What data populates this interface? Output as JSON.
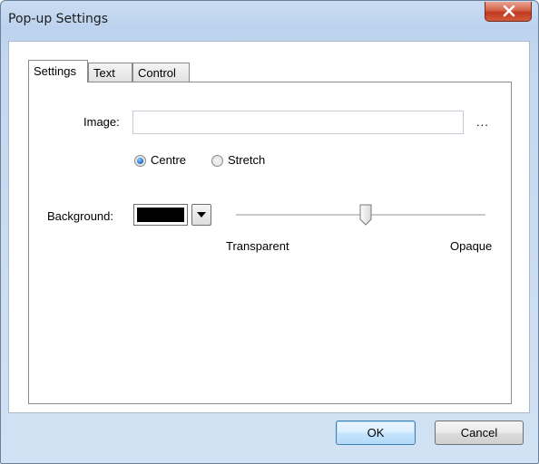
{
  "window": {
    "title": "Pop-up Settings"
  },
  "tabs": [
    {
      "label": "Settings",
      "active": true
    },
    {
      "label": "Text",
      "active": false
    },
    {
      "label": "Control",
      "active": false
    }
  ],
  "settings": {
    "image_label": "Image:",
    "image_value": "",
    "browse_label": "...",
    "radio_centre": "Centre",
    "radio_stretch": "Stretch",
    "selected_mode": "Centre",
    "background_label": "Background:",
    "background_color": "#000000",
    "opacity_min_label": "Transparent",
    "opacity_max_label": "Opaque",
    "opacity_level": 0.52
  },
  "buttons": {
    "ok": "OK",
    "cancel": "Cancel"
  },
  "icons": {
    "close": "close-icon",
    "dropdown": "chevron-down-icon",
    "slider": "slider-thumb-icon"
  }
}
